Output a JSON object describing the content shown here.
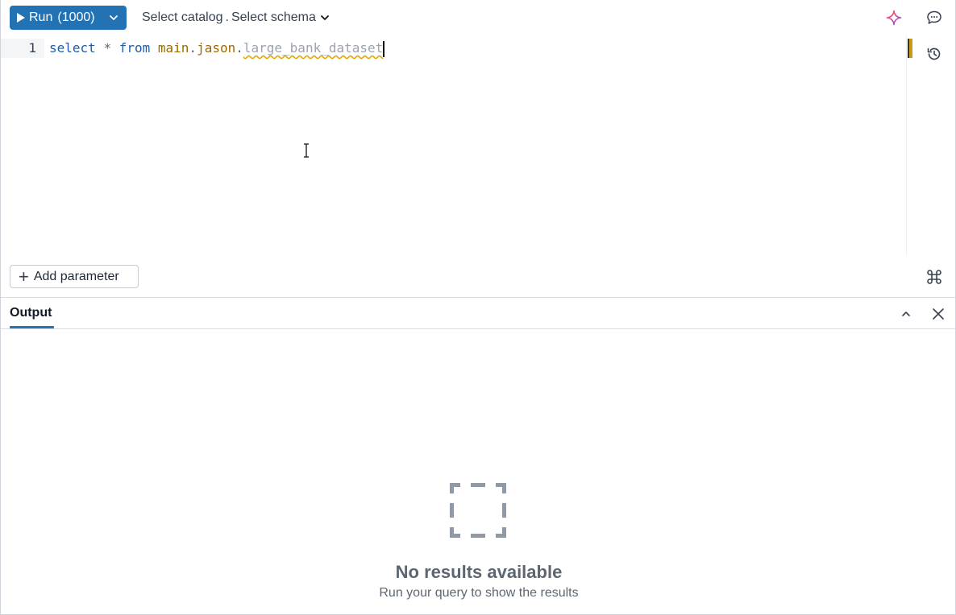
{
  "toolbar": {
    "run_label": "Run",
    "run_limit": "(1000)",
    "catalog": "Select catalog",
    "separator": ".",
    "schema": "Select schema"
  },
  "editor": {
    "line_number": "1",
    "code": {
      "keyword_select": "select",
      "star": "*",
      "keyword_from": "from",
      "catalog": "main",
      "dot1": ".",
      "schema": "jason",
      "dot2": ".",
      "table": "large_bank_dataset"
    }
  },
  "parameters": {
    "add_label": "Add parameter"
  },
  "output": {
    "tab_label": "Output",
    "empty_title": "No results available",
    "empty_subtitle": "Run your query to show the results"
  },
  "colors": {
    "accent": "#2272b4",
    "keyword": "#1d5ea8",
    "identifier": "#9a6a00"
  },
  "icons": [
    "play-icon",
    "chevron-down-icon",
    "assistant-sparkle-icon",
    "comment-icon",
    "history-icon",
    "command-key-icon",
    "collapse-chevron-icon",
    "close-icon",
    "empty-results-icon"
  ]
}
